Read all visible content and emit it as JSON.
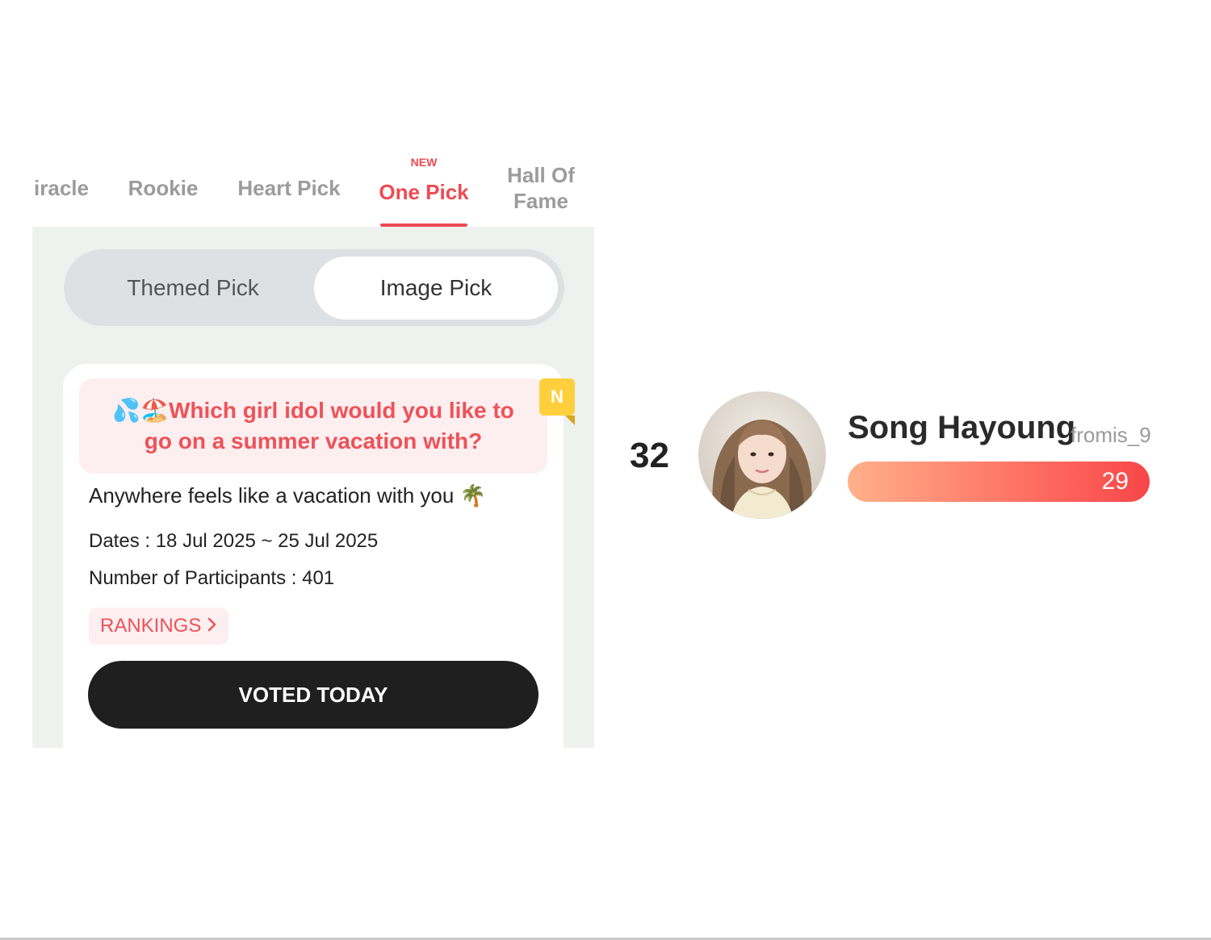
{
  "tabs": [
    {
      "label": "iracle"
    },
    {
      "label": "Rookie"
    },
    {
      "label": "Heart Pick"
    },
    {
      "label": "One Pick",
      "badge": "NEW",
      "active": true
    },
    {
      "label": "Hall Of Fame"
    }
  ],
  "segmented": {
    "themed_label": "Themed Pick",
    "image_label": "Image Pick",
    "selected": "Image Pick"
  },
  "card": {
    "new_badge": "N",
    "question": "💦🏖️Which girl idol would you like to go on a summer vacation with?",
    "description": "Anywhere feels like a vacation with you 🌴",
    "dates": "Dates : 18 Jul 2025 ~ 25 Jul 2025",
    "participants": "Number of Participants : 401",
    "rankings_label": "RANKINGS",
    "voted_label": "VOTED TODAY"
  },
  "ranking_entry": {
    "rank": "32",
    "name": "Song Hayoung",
    "group": "fromis_9",
    "votes": "29",
    "bar_fill_percent": 100
  },
  "colors": {
    "accent": "#ee4a52",
    "inactive_tab": "#9b9b9b",
    "panel_bg": "#eef2ef",
    "question_bg": "#fdeef0",
    "badge_yellow": "#ffcf3e",
    "button_dark": "#1f1f1f",
    "bar_gradient_start": "#ffb08a",
    "bar_gradient_end": "#f84648"
  }
}
